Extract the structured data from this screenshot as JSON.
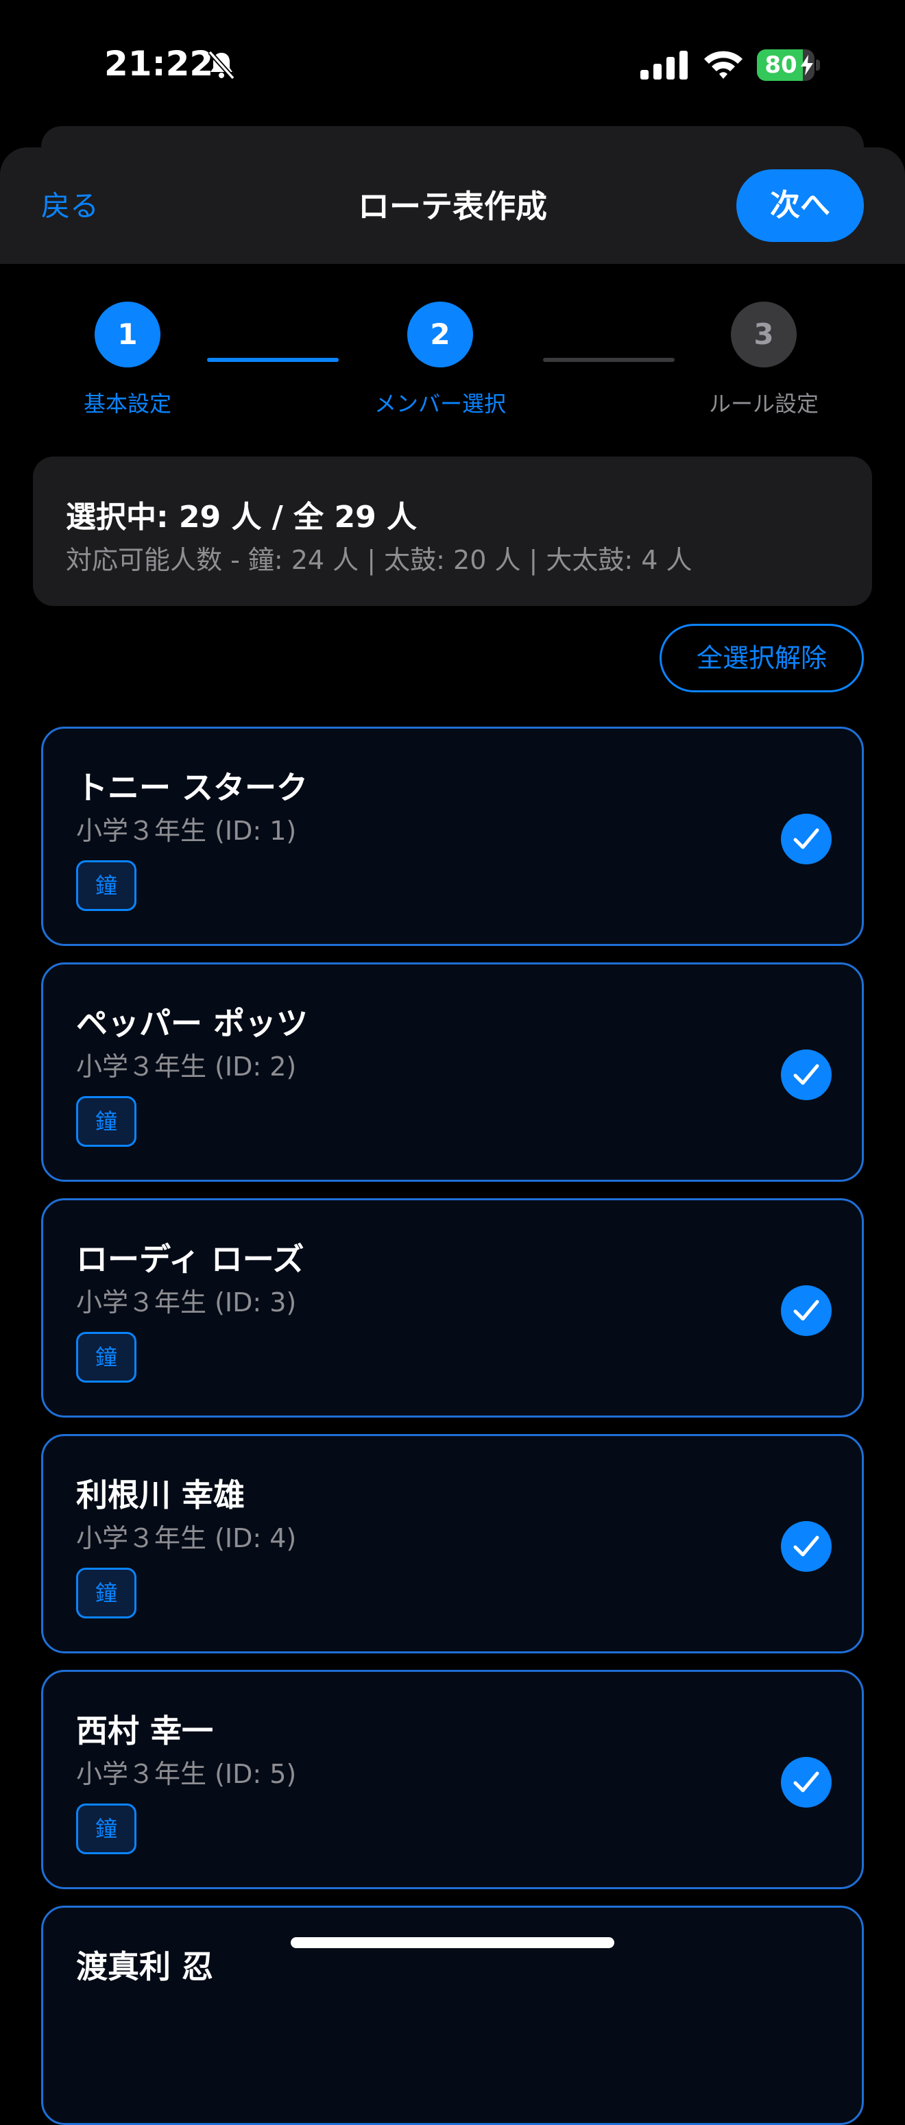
{
  "status_bar": {
    "time": "21:22",
    "battery_level": "80",
    "battery_fraction": 0.8,
    "icons": [
      "bell-slash-icon",
      "cellular-signal-icon",
      "wifi-icon",
      "battery-charging-icon"
    ]
  },
  "header": {
    "back_label": "戻る",
    "title": "ローテ表作成",
    "next_label": "次へ"
  },
  "stepper": {
    "steps": [
      {
        "number": "1",
        "label": "基本設定",
        "state": "active"
      },
      {
        "number": "2",
        "label": "メンバー選択",
        "state": "active"
      },
      {
        "number": "3",
        "label": "ルール設定",
        "state": "inactive"
      }
    ]
  },
  "summary": {
    "title": "選択中: 29 人 / 全 29 人",
    "subtitle": "対応可能人数 - 鐘: 24 人 | 太鼓: 20 人 | 大太鼓: 4 人"
  },
  "deselect_all_label": "全選択解除",
  "members": [
    {
      "name": "トニー スターク",
      "sub": "小学３年生 (ID: 1)",
      "tag": "鐘",
      "selected": true
    },
    {
      "name": "ペッパー ポッツ",
      "sub": "小学３年生 (ID: 2)",
      "tag": "鐘",
      "selected": true
    },
    {
      "name": "ローディ ローズ",
      "sub": "小学３年生 (ID: 3)",
      "tag": "鐘",
      "selected": true
    },
    {
      "name": "利根川 幸雄",
      "sub": "小学３年生 (ID: 4)",
      "tag": "鐘",
      "selected": true
    },
    {
      "name": "西村 幸一",
      "sub": "小学３年生 (ID: 5)",
      "tag": "鐘",
      "selected": true
    },
    {
      "name": "渡真利 忍",
      "sub": "",
      "tag": "",
      "selected": true
    }
  ],
  "colors": {
    "accent": "#0a84ff",
    "background": "#000000",
    "card": "#1c1c1e",
    "battery_green": "#34c759"
  }
}
